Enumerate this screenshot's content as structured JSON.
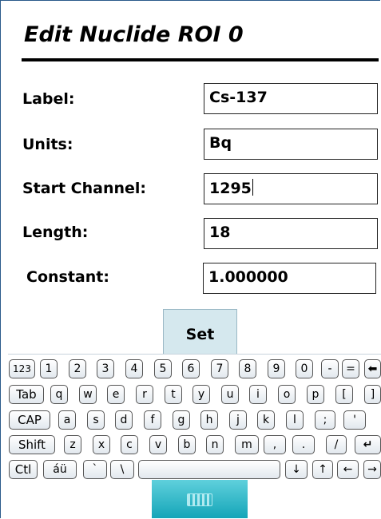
{
  "dialog": {
    "title": "Edit Nuclide ROI 0",
    "fields": {
      "label": {
        "label": "Label:",
        "value": "Cs-137"
      },
      "units": {
        "label": "Units:",
        "value": "Bq"
      },
      "start_channel": {
        "label": "Start Channel:",
        "value": "1295"
      },
      "length": {
        "label": "Length:",
        "value": "18"
      },
      "constant": {
        "label": "Constant:",
        "value": "1.000000"
      }
    },
    "set_label": "Set"
  },
  "keyboard": {
    "row1": [
      "123",
      "1",
      "2",
      "3",
      "4",
      "5",
      "6",
      "7",
      "8",
      "9",
      "0",
      "-",
      "=",
      "⬅"
    ],
    "row2": [
      "Tab",
      "q",
      "w",
      "e",
      "r",
      "t",
      "y",
      "u",
      "i",
      "o",
      "p",
      "[",
      "]"
    ],
    "row3": [
      "CAP",
      "a",
      "s",
      "d",
      "f",
      "g",
      "h",
      "j",
      "k",
      "l",
      ";",
      "'"
    ],
    "row4": [
      "Shift",
      "z",
      "x",
      "c",
      "v",
      "b",
      "n",
      "m",
      ",",
      ".",
      "/",
      "↵"
    ],
    "row5": [
      "Ctl",
      "áü",
      "`",
      "\\",
      "",
      "↓",
      "↑",
      "←",
      "→"
    ],
    "toggle_icon": "keyboard-icon"
  }
}
